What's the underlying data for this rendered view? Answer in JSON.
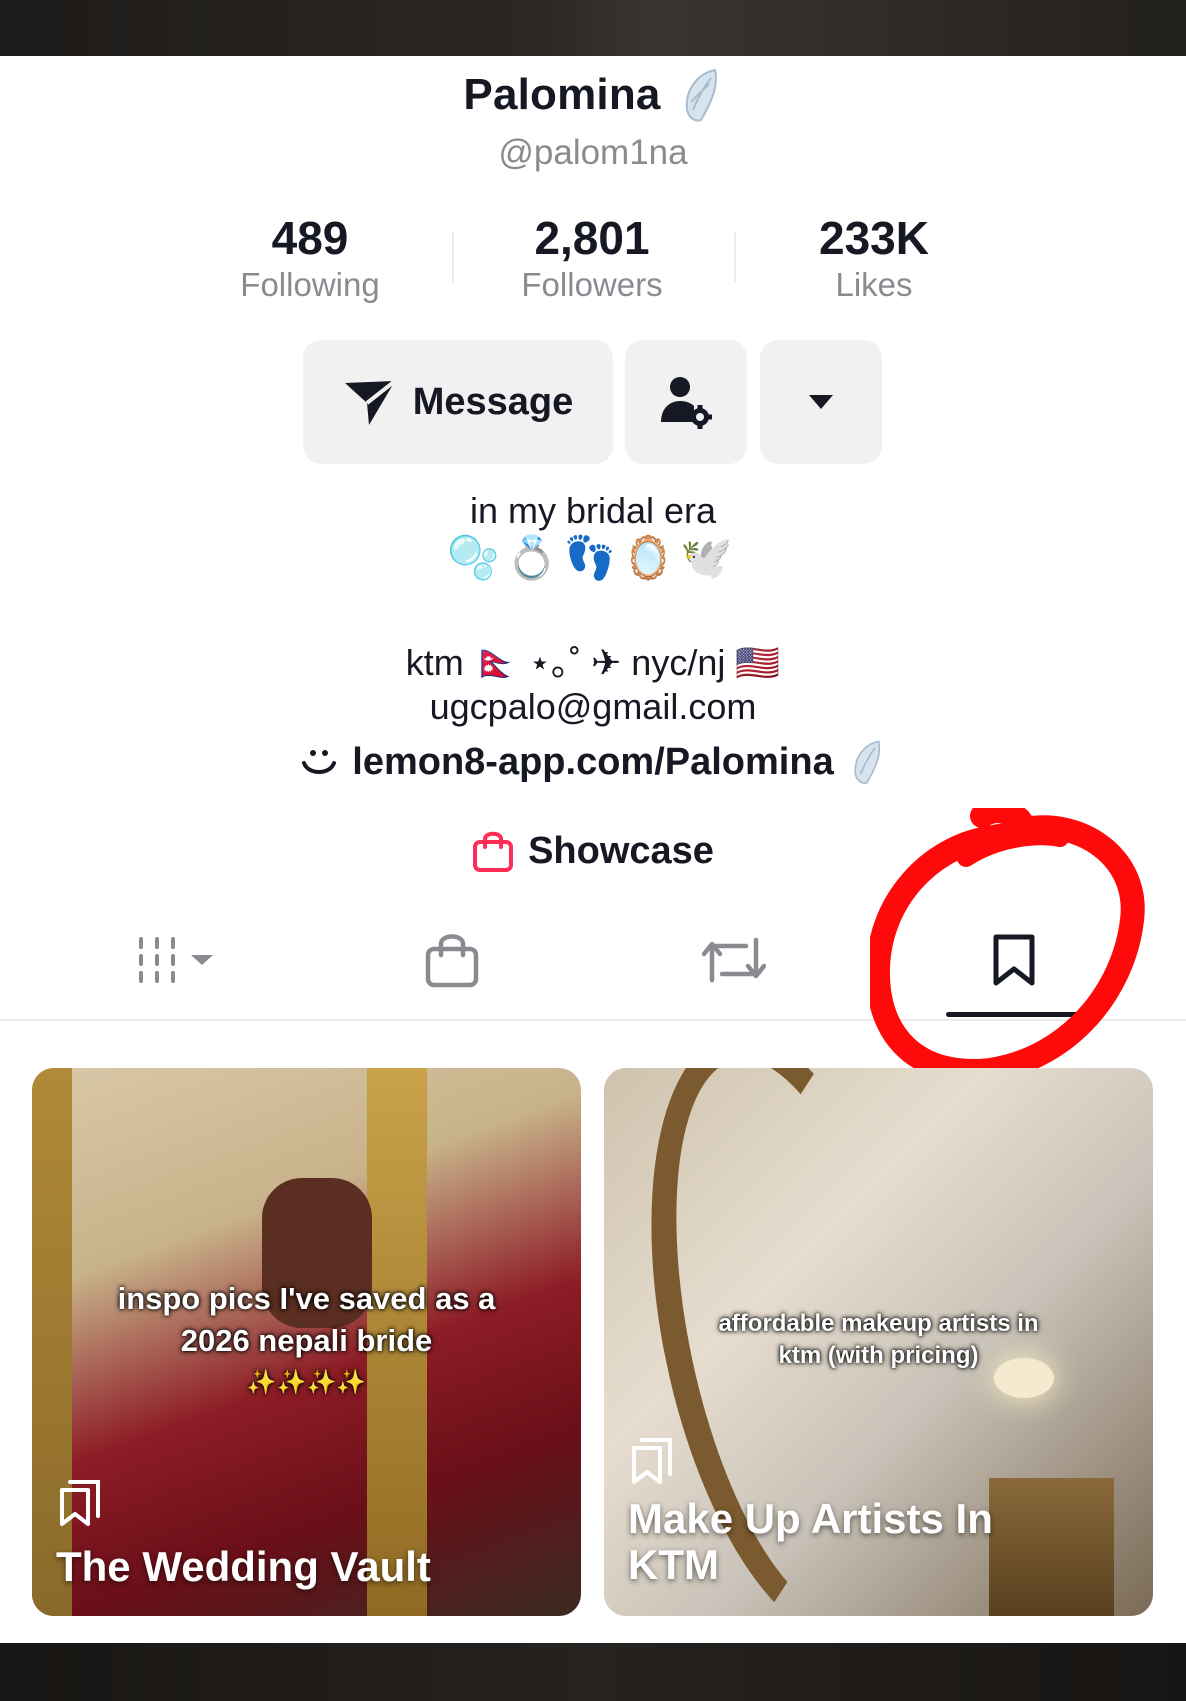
{
  "profile": {
    "name": "Palomina",
    "handle": "@palom1na"
  },
  "stats": [
    {
      "value": "489",
      "label": "Following"
    },
    {
      "value": "2,801",
      "label": "Followers"
    },
    {
      "value": "233K",
      "label": "Likes"
    }
  ],
  "actions": {
    "message_label": "Message"
  },
  "bio": {
    "line1": "in my bridal era",
    "line2": "🫧💍👣🪞🕊️",
    "line3": "ktm 🇳🇵 ⋆｡˚ ✈︎ nyc/nj 🇺🇸",
    "email": "ugcpalo@gmail.com",
    "link": "lemon8-app.com/Palomina"
  },
  "showcase": {
    "label": "Showcase"
  },
  "tabs": {
    "items": [
      "grid",
      "shop",
      "reposts",
      "saved"
    ],
    "active": "saved"
  },
  "collections": [
    {
      "caption": "inspo pics I've saved as a 2026 nepali bride",
      "caption_emoji": "✨✨✨✨",
      "title": "The Wedding Vault"
    },
    {
      "caption": "affordable makeup artists in ktm (with pricing)",
      "title": "Make Up Artists In KTM"
    }
  ],
  "colors": {
    "annotation": "#ff0a0a",
    "showcase_icon": "#fe2c55",
    "text_primary": "#161823",
    "text_secondary": "#8a8b91"
  }
}
